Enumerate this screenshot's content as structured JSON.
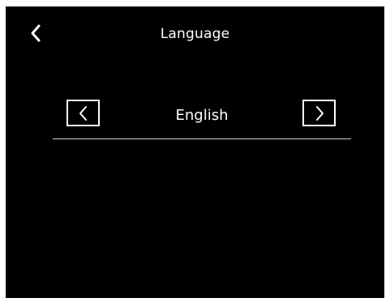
{
  "header": {
    "title": "Language",
    "back_icon": "chevron-left-icon"
  },
  "language_selector": {
    "selected": "English",
    "prev_icon": "chevron-left-icon",
    "next_icon": "chevron-right-icon"
  },
  "colors": {
    "background": "#000000",
    "foreground": "#ffffff",
    "divider": "#cfcfcf"
  }
}
